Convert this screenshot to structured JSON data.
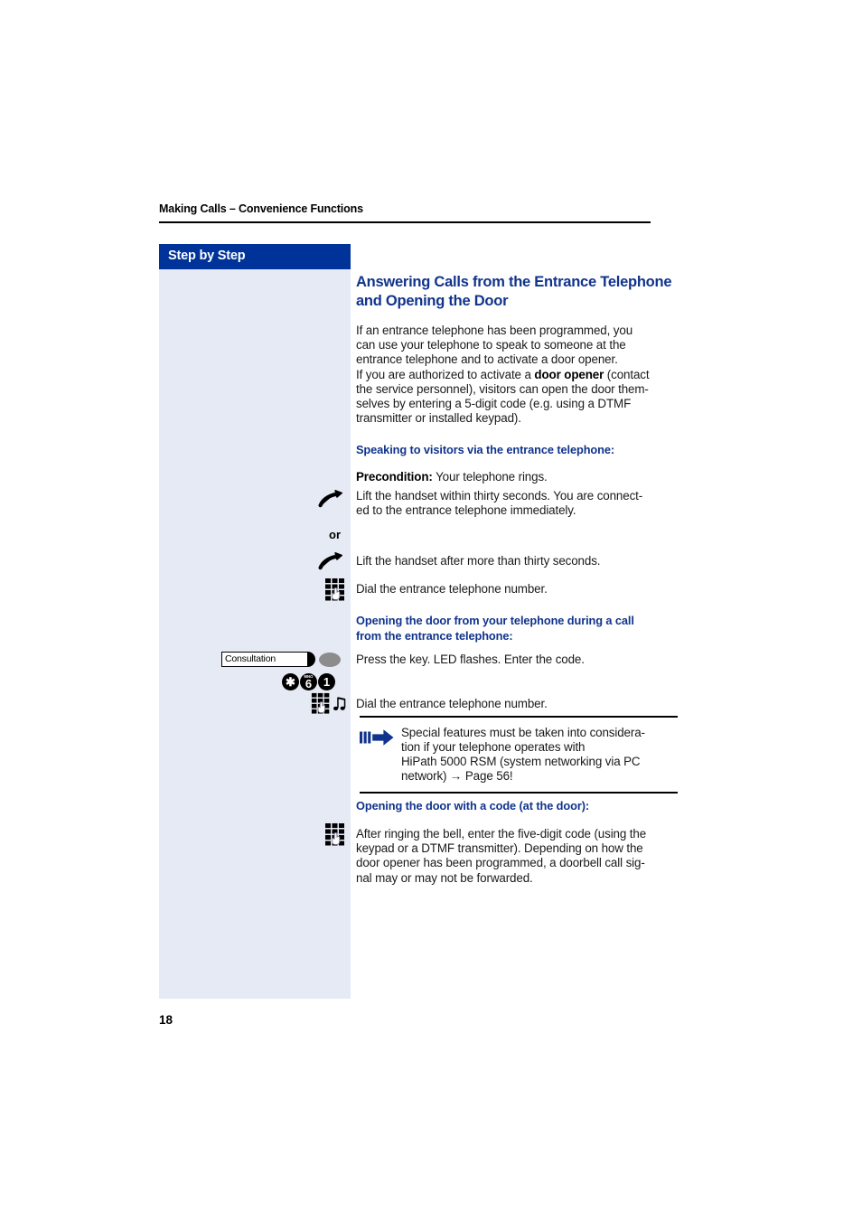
{
  "page": {
    "running_head": "Making Calls – Convenience Functions",
    "page_number": "18",
    "accent_blue": "#10338c",
    "sidebar_header_blue": "#00339a",
    "sidebar_fill": "#e6eaf5"
  },
  "sidebar": {
    "header_label": "Step by Step"
  },
  "main": {
    "title_line1": "Answering Calls from the Entrance Telephone",
    "title_line2": "and Opening the Door",
    "intro": {
      "line1": "If an entrance telephone has been programmed, you",
      "line2": "can use your telephone to speak to someone at the",
      "line3": "entrance telephone and to activate a door opener.",
      "line4_a": "If you are authorized to activate a ",
      "line4_bold": "door opener",
      "line4_b": " (contact",
      "line5": "the service personnel), visitors can open the door them-",
      "line6": "selves by entering a 5-digit code (e.g. using a DTMF",
      "line7": "transmitter or installed keypad)."
    },
    "section_speaking": {
      "heading": "Speaking to visitors via the entrance telephone:",
      "precondition_bold": "Precondition:",
      "precondition_rest": " Your telephone rings.",
      "step1_line1": "Lift the handset within thirty seconds. You are connect-",
      "step1_line2": "ed to the entrance telephone immediately.",
      "or": "or",
      "step2": "Lift the handset after more than thirty seconds.",
      "step3": "Dial the entrance telephone number."
    },
    "section_opening_during_call": {
      "heading_line1": "Opening the door from your telephone during a call",
      "heading_line2": "from the entrance telephone:",
      "key_label": "Consultation",
      "step1": "Press the key. LED flashes. Enter the code.",
      "code_keys": [
        {
          "digit": "✱",
          "alpha": ""
        },
        {
          "digit": "6",
          "alpha": "MNO"
        },
        {
          "digit": "1",
          "alpha": ""
        }
      ],
      "step2": "Dial the entrance telephone number."
    },
    "note": {
      "line1": "Special features must be taken into considera-",
      "line2": "tion if your telephone operates with",
      "line3": "HiPath 5000 RSM (system networking via PC",
      "line4": "network) → Page 56!"
    },
    "section_opening_with_code": {
      "heading": "Opening the door with a code (at the door):",
      "body_line1": "After ringing the bell, enter the five-digit code (using the",
      "body_line2": "keypad or a DTMF transmitter). Depending on how the",
      "body_line3": "door opener has been programmed, a doorbell call sig-",
      "body_line4": "nal may or may not be forwarded."
    }
  },
  "icons": {
    "handset_1": "handset-lift-icon",
    "handset_2": "handset-lift-icon",
    "keypad_1": "keypad-dial-icon",
    "keypad_2": "keypad-dial-icon",
    "keypad_3": "keypad-dial-icon",
    "tone": "tone-note-icon",
    "note_arrow": "note-arrow-icon"
  }
}
